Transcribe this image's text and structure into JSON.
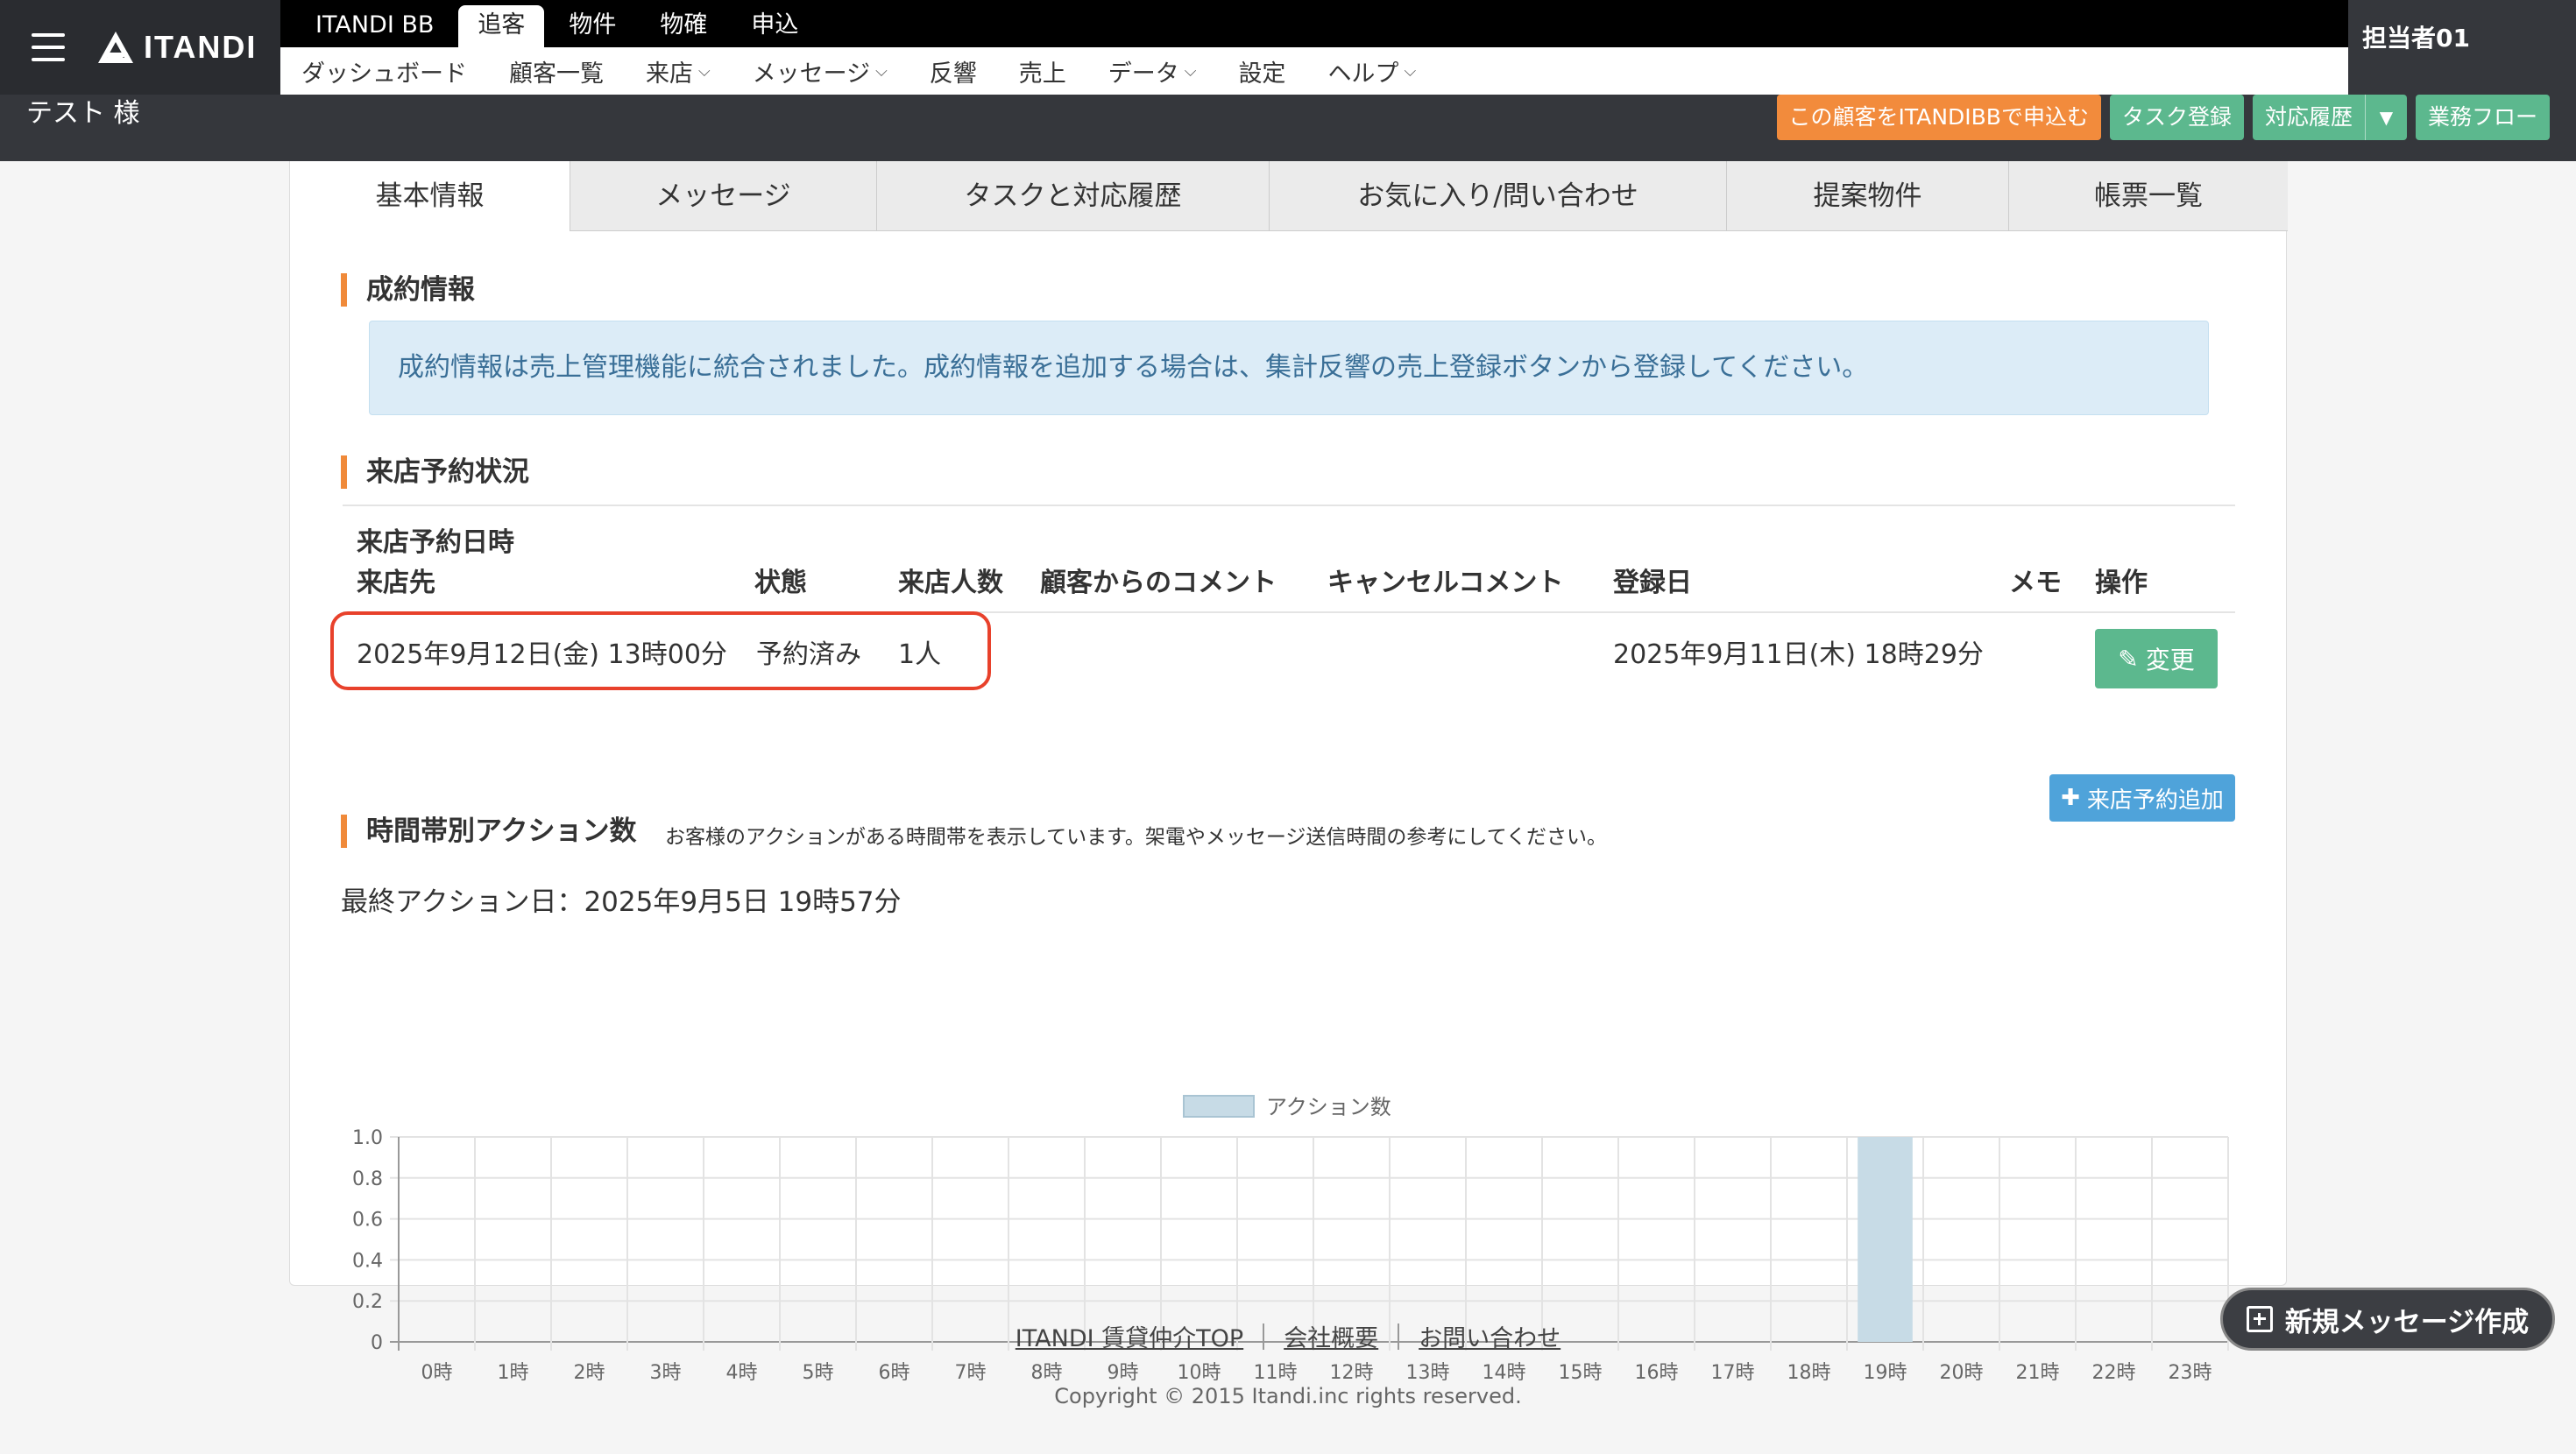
{
  "header": {
    "logo_text": "ITANDI",
    "customer_name": "テスト 様",
    "user": "担当者01",
    "main_tabs": [
      "ITANDI BB",
      "追客",
      "物件",
      "物確",
      "申込"
    ],
    "sub_tabs": [
      "ダッシュボード",
      "顧客一覧",
      "来店",
      "メッセージ",
      "反響",
      "売上",
      "データ",
      "設定",
      "ヘルプ"
    ],
    "actions": {
      "apply_itandibb": "この顧客をITANDIBBで申込む",
      "register_task": "タスク登録",
      "history": "対応履歴",
      "workflow": "業務フロー"
    }
  },
  "tabs": [
    "基本情報",
    "メッセージ",
    "タスクと対応履歴",
    "お気に入り/問い合わせ",
    "提案物件",
    "帳票一覧"
  ],
  "contract": {
    "title": "成約情報",
    "notice": "成約情報は売上管理機能に統合されました。成約情報を追加する場合は、集計反響の売上登録ボタンから登録してください。"
  },
  "reservation": {
    "title": "来店予約状況",
    "headers": {
      "datetime": "来店予約日時",
      "place": "来店先",
      "status": "状態",
      "count": "来店人数",
      "customer_comment": "顧客からのコメント",
      "cancel_comment": "キャンセルコメント",
      "registered": "登録日",
      "memo": "メモ",
      "ops": "操作"
    },
    "row": {
      "datetime": "2025年9月12日(金) 13時00分",
      "status": "予約済み",
      "count": "1人",
      "registered": "2025年9月11日(木) 18時29分"
    },
    "change_button": "変更",
    "add_button": "来店予約追加"
  },
  "action_chart": {
    "title": "時間帯別アクション数",
    "note": "お客様のアクションがある時間帯を表示しています。架電やメッセージ送信時間の参考にしてください。",
    "last_action": "最終アクション日：2025年9月5日 19時57分"
  },
  "chart_data": {
    "type": "bar",
    "categories": [
      "0時",
      "1時",
      "2時",
      "3時",
      "4時",
      "5時",
      "6時",
      "7時",
      "8時",
      "9時",
      "10時",
      "11時",
      "12時",
      "13時",
      "14時",
      "15時",
      "16時",
      "17時",
      "18時",
      "19時",
      "20時",
      "21時",
      "22時",
      "23時"
    ],
    "series": [
      {
        "name": "アクション数",
        "values": [
          0,
          0,
          0,
          0,
          0,
          0,
          0,
          0,
          0,
          0,
          0,
          0,
          0,
          0,
          0,
          0,
          0,
          0,
          0,
          1,
          0,
          0,
          0,
          0
        ]
      }
    ],
    "yticks": [
      "0",
      "0.2",
      "0.4",
      "0.6",
      "0.8",
      "1.0"
    ],
    "ylim": [
      0,
      1
    ],
    "grid": true,
    "legend": "top-center",
    "color": "#c7dbe6"
  },
  "footer": {
    "links": [
      "ITANDI 賃貸仲介TOP",
      "会社概要",
      "お問い合わせ"
    ],
    "copyright": "Copyright © 2015 Itandi.inc rights reserved."
  },
  "new_message_button": "新規メッセージ作成"
}
